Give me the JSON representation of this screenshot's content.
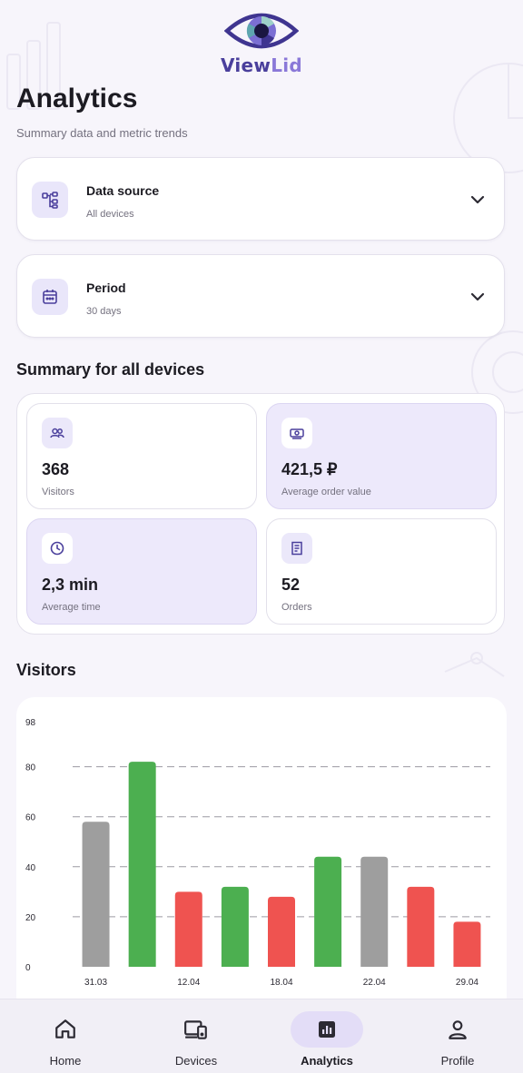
{
  "app": {
    "logo_text_view": "View",
    "logo_text_lid": "Lid"
  },
  "header": {
    "title": "Analytics",
    "subtitle": "Summary data and metric trends"
  },
  "filters": [
    {
      "label": "Data source",
      "value": "All devices",
      "icon": "hierarchy-icon"
    },
    {
      "label": "Period",
      "value": "30 days",
      "icon": "calendar-icon"
    }
  ],
  "summary": {
    "title": "Summary for all devices",
    "metrics": [
      {
        "value": "368",
        "label": "Visitors",
        "icon": "users-icon",
        "tinted": false
      },
      {
        "value": "421,5 ₽",
        "label": "Average order value",
        "icon": "money-icon",
        "tinted": true
      },
      {
        "value": "2,3 min",
        "label": "Average time",
        "icon": "clock-icon",
        "tinted": true
      },
      {
        "value": "52",
        "label": "Orders",
        "icon": "receipt-icon",
        "tinted": false
      }
    ]
  },
  "visitors": {
    "title": "Visitors"
  },
  "chart_data": {
    "type": "bar",
    "categories": [
      "31.03",
      "",
      "12.04",
      "",
      "18.04",
      "",
      "22.04",
      "",
      "29.04"
    ],
    "values": [
      58,
      82,
      30,
      32,
      28,
      44,
      44,
      32,
      18
    ],
    "bar_colors": [
      "#9e9e9e",
      "#4caf50",
      "#ef5350",
      "#4caf50",
      "#ef5350",
      "#4caf50",
      "#9e9e9e",
      "#ef5350",
      "#ef5350"
    ],
    "yticks": [
      0,
      20,
      40,
      60,
      80,
      98
    ],
    "ylim": [
      0,
      98
    ],
    "grid": "dashed horizontal",
    "title": "",
    "xlabel": "",
    "ylabel": ""
  },
  "nav": {
    "items": [
      {
        "label": "Home",
        "icon": "home-icon"
      },
      {
        "label": "Devices",
        "icon": "devices-icon"
      },
      {
        "label": "Analytics",
        "icon": "analytics-icon",
        "active": true
      },
      {
        "label": "Profile",
        "icon": "profile-icon"
      }
    ]
  },
  "colors": {
    "accent": "#5b4fc4",
    "tint": "#ede9fb",
    "green": "#4caf50",
    "red": "#ef5350",
    "grey": "#9e9e9e"
  }
}
